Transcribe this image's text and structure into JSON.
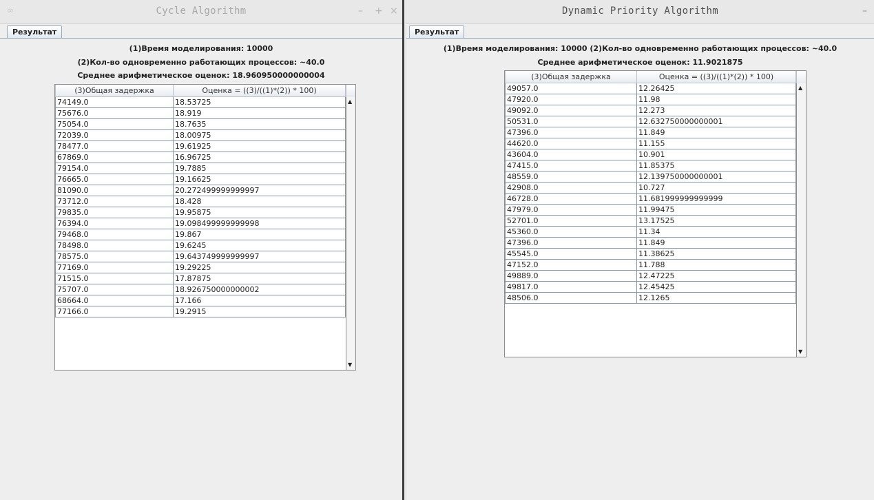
{
  "left_window": {
    "title": "Cycle Algorithm",
    "tab": "Результат",
    "line1": "(1)Время моделирования: 10000",
    "line2": "(2)Кол-во одновременно работающих процессов: ~40.0",
    "line3": "Среднее арифметическое оценок: 18.960950000000004",
    "columns": [
      "(3)Общая задержка",
      "Оценка = ((3)/((1)*(2)) * 100)"
    ],
    "rows": [
      [
        "74149.0",
        "18.53725"
      ],
      [
        "75676.0",
        "18.919"
      ],
      [
        "75054.0",
        "18.7635"
      ],
      [
        "72039.0",
        "18.00975"
      ],
      [
        "78477.0",
        "19.61925"
      ],
      [
        "67869.0",
        "16.96725"
      ],
      [
        "79154.0",
        "19.7885"
      ],
      [
        "76665.0",
        "19.16625"
      ],
      [
        "81090.0",
        "20.272499999999997"
      ],
      [
        "73712.0",
        "18.428"
      ],
      [
        "79835.0",
        "19.95875"
      ],
      [
        "76394.0",
        "19.098499999999998"
      ],
      [
        "79468.0",
        "19.867"
      ],
      [
        "78498.0",
        "19.6245"
      ],
      [
        "78575.0",
        "19.643749999999997"
      ],
      [
        "77169.0",
        "19.29225"
      ],
      [
        "71515.0",
        "17.87875"
      ],
      [
        "75707.0",
        "18.926750000000002"
      ],
      [
        "68664.0",
        "17.166"
      ],
      [
        "77166.0",
        "19.2915"
      ]
    ]
  },
  "right_window": {
    "title": "Dynamic Priority Algorithm",
    "tab": "Результат",
    "line1": "(1)Время моделирования: 10000 (2)Кол-во одновременно работающих процессов: ~40.0",
    "line2": "Среднее арифметическое оценок: 11.9021875",
    "columns": [
      "(3)Общая задержка",
      "Оценка = ((3)/((1)*(2)) * 100)"
    ],
    "rows": [
      [
        "49057.0",
        "12.26425"
      ],
      [
        "47920.0",
        "11.98"
      ],
      [
        "49092.0",
        "12.273"
      ],
      [
        "50531.0",
        "12.632750000000001"
      ],
      [
        "47396.0",
        "11.849"
      ],
      [
        "44620.0",
        "11.155"
      ],
      [
        "43604.0",
        "10.901"
      ],
      [
        "47415.0",
        "11.85375"
      ],
      [
        "48559.0",
        "12.139750000000001"
      ],
      [
        "42908.0",
        "10.727"
      ],
      [
        "46728.0",
        "11.681999999999999"
      ],
      [
        "47979.0",
        "11.99475"
      ],
      [
        "52701.0",
        "13.17525"
      ],
      [
        "45360.0",
        "11.34"
      ],
      [
        "47396.0",
        "11.849"
      ],
      [
        "45545.0",
        "11.38625"
      ],
      [
        "47152.0",
        "11.788"
      ],
      [
        "49889.0",
        "12.47225"
      ],
      [
        "49817.0",
        "12.45425"
      ],
      [
        "48506.0",
        "12.1265"
      ]
    ]
  }
}
